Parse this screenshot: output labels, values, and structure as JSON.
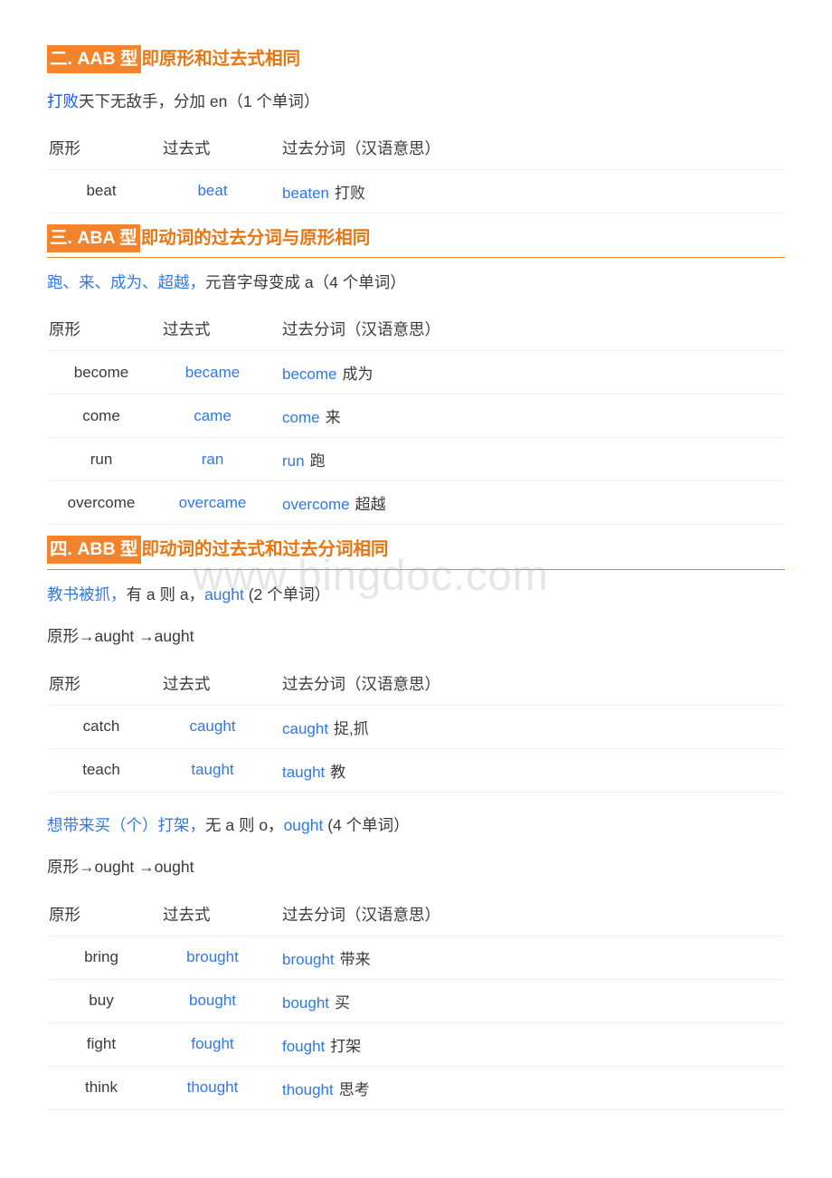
{
  "watermark": "www.bingdoc.com",
  "colors": {
    "heading_orange": "#E8750F",
    "highlight_orange": "#F5832B",
    "blue_strong": "#1658f5",
    "blue_link": "#2f78e8",
    "text": "#3a3a3a",
    "rule": "#F5832B"
  },
  "table_headers": {
    "base": "原形",
    "past": "过去式",
    "participle": "过去分词（汉语意思）"
  },
  "sections": [
    {
      "id": "aab",
      "heading_highlight": "二. AAB 型",
      "heading_plain": "即原形和过去式相同",
      "has_rule": false,
      "intro_blue": "打败",
      "intro_rest": "天下无敌手，分加 en（1 个单词）",
      "rows": [
        {
          "base": "beat",
          "past": "beat",
          "participle": "beaten",
          "meaning": "打败"
        }
      ]
    },
    {
      "id": "aba",
      "heading_highlight": "三. ABA 型",
      "heading_plain": "即动词的过去分词与原形相同",
      "has_rule": true,
      "intro_blue": "跑、来、成为、超越，",
      "intro_rest": "元音字母变成 a（4 个单词）",
      "rows": [
        {
          "base": "become",
          "past": "became",
          "participle": "become",
          "meaning": "成为"
        },
        {
          "base": "come",
          "past": "came",
          "participle": "come",
          "meaning": "来"
        },
        {
          "base": "run",
          "past": "ran",
          "participle": "run",
          "meaning": "跑"
        },
        {
          "base": "overcome",
          "past": "overcame",
          "participle": "overcome",
          "meaning": "超越"
        }
      ]
    },
    {
      "id": "abb",
      "heading_highlight": "四. ABB 型",
      "heading_plain": "即动词的过去式和过去分词相同",
      "has_rule": true,
      "groups": [
        {
          "intro_blue_1": "教书被抓，",
          "intro_mid": "有 a 则 a，",
          "intro_blue_2": "aught",
          "intro_tail": " (2 个单词）",
          "formula": "原形→aught →aught",
          "rows": [
            {
              "base": "catch",
              "past": "caught",
              "participle": "caught",
              "meaning": "捉,抓"
            },
            {
              "base": "teach",
              "past": "taught",
              "participle": "taught",
              "meaning": "教"
            }
          ]
        },
        {
          "intro_blue_1": "想带来买（个）打架，",
          "intro_mid": "无 a 则 o，",
          "intro_blue_2": "ought",
          "intro_tail": " (4 个单词）",
          "formula": "原形→ought →ought",
          "rows": [
            {
              "base": "bring",
              "past": "brought",
              "participle": "brought",
              "meaning": "带来"
            },
            {
              "base": "buy",
              "past": "bought",
              "participle": "bought",
              "meaning": "买"
            },
            {
              "base": "fight",
              "past": "fought",
              "participle": "fought",
              "meaning": "打架"
            },
            {
              "base": "think",
              "past": "thought",
              "participle": "thought",
              "meaning": "思考"
            }
          ]
        }
      ]
    }
  ]
}
